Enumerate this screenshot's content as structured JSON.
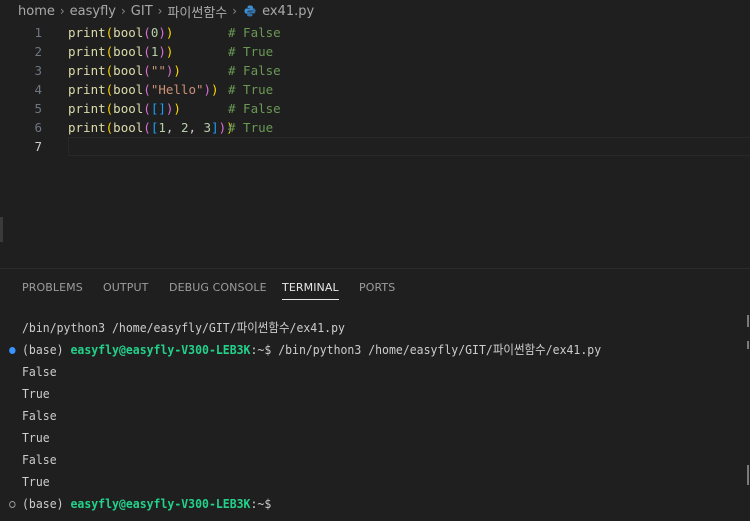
{
  "breadcrumb": {
    "items": [
      "home",
      "easyfly",
      "GIT",
      "파이썬함수"
    ],
    "file": "ex41.py",
    "file_icon": "python-icon"
  },
  "editor": {
    "lines": [
      {
        "num": "1",
        "code": "print(bool(0))",
        "comment": "# False"
      },
      {
        "num": "2",
        "code": "print(bool(1))",
        "comment": "# True"
      },
      {
        "num": "3",
        "code": "print(bool(\"\"))",
        "comment": "# False"
      },
      {
        "num": "4",
        "code": "print(bool(\"Hello\"))",
        "comment": "# True"
      },
      {
        "num": "5",
        "code": "print(bool([]))",
        "comment": "# False"
      },
      {
        "num": "6",
        "code": "print(bool([1, 2, 3]))",
        "comment": "# True"
      },
      {
        "num": "7",
        "code": "",
        "comment": ""
      }
    ]
  },
  "panel": {
    "tabs": [
      "PROBLEMS",
      "OUTPUT",
      "DEBUG CONSOLE",
      "TERMINAL",
      "PORTS"
    ],
    "active_tab": "TERMINAL"
  },
  "terminal": {
    "command_echo": "/bin/python3 /home/easyfly/GIT/파이썬함수/ex41.py",
    "prompt_env": "(base)",
    "prompt_user": "easyfly@easyfly-V300-LEB3K",
    "prompt_path": ":~$",
    "command": "/bin/python3 /home/easyfly/GIT/파이썬함수/ex41.py",
    "output": [
      "False",
      "True",
      "False",
      "True",
      "False",
      "True"
    ]
  },
  "colors": {
    "accent": "#3794ff",
    "prompt_user": "#23d18b",
    "comment": "#6a9955"
  }
}
